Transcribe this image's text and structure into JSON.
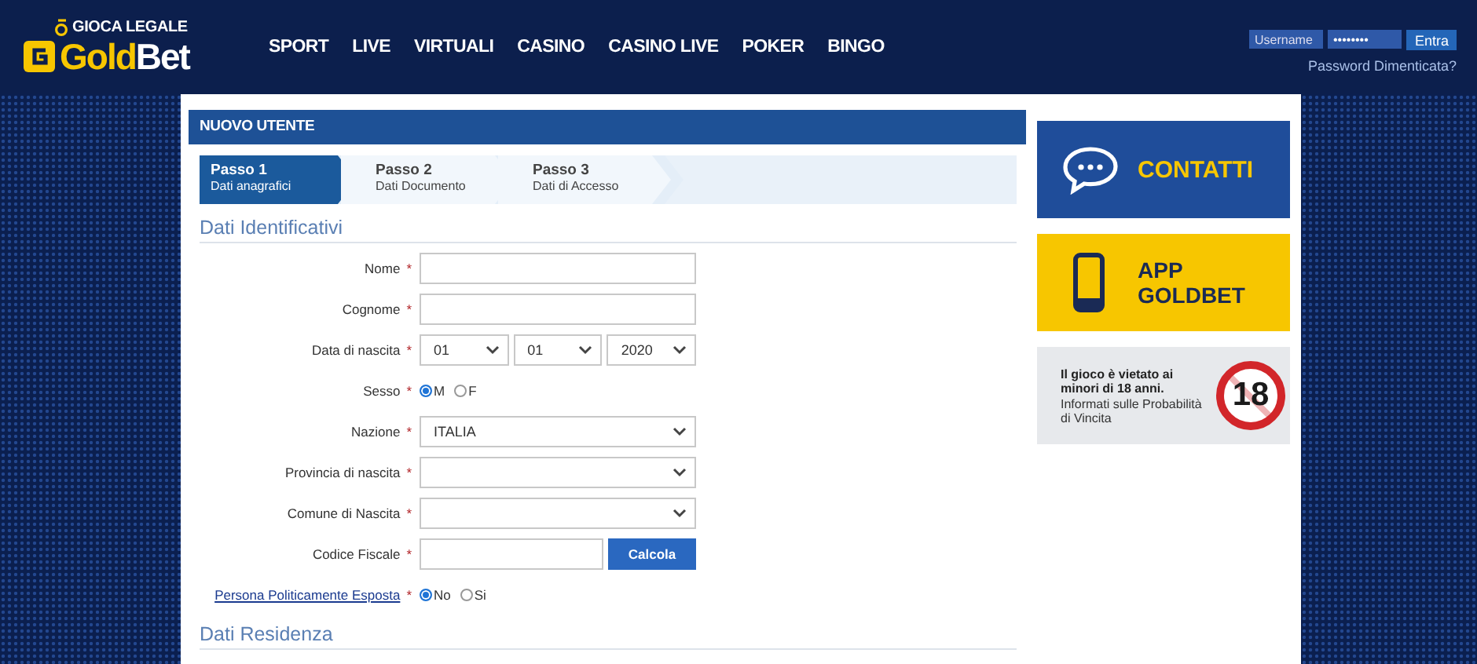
{
  "header": {
    "logo": {
      "tagline": "GIOCA LEGALE",
      "brand": [
        {
          "text": "Gold",
          "color": "#f7c600"
        },
        {
          "text": "Bet",
          "color": "#ffffff"
        }
      ]
    },
    "nav": [
      "SPORT",
      "LIVE",
      "VIRTUALI",
      "CASINO",
      "CASINO LIVE",
      "POKER",
      "BINGO"
    ],
    "login": {
      "username": {
        "placeholder": "Username"
      },
      "password": {
        "value": "••••••••"
      },
      "button": "Entra",
      "forgot_link": "Password Dimenticata?"
    }
  },
  "panel": {
    "title": "NUOVO UTENTE",
    "steps": [
      {
        "title": "Passo 1",
        "subtitle": "Dati anagrafici",
        "selected": true
      },
      {
        "title": "Passo 2",
        "subtitle": "Dati Documento",
        "selected": false
      },
      {
        "title": "Passo 3",
        "subtitle": "Dati di Accesso",
        "selected": false
      }
    ],
    "sections": [
      {
        "heading": "Dati Identificativi",
        "fields": [
          {
            "label": "Nome",
            "label_link": false,
            "mark": "*",
            "kind": "text"
          },
          {
            "label": "Cognome",
            "label_link": false,
            "mark": "*",
            "kind": "text"
          },
          {
            "label": "Data di nascita",
            "label_link": false,
            "mark": "*",
            "kind": "date",
            "values": [
              "01",
              "01",
              "2020"
            ]
          },
          {
            "label": "Sesso",
            "label_link": false,
            "mark": "*",
            "kind": "radio",
            "options": [
              {
                "label": "M",
                "selected": true
              },
              {
                "label": "F",
                "selected": false
              }
            ]
          },
          {
            "label": "Nazione",
            "label_link": false,
            "mark": "*",
            "kind": "select",
            "value": "ITALIA"
          },
          {
            "label": "Provincia di nascita",
            "label_link": false,
            "mark": "*",
            "kind": "select"
          },
          {
            "label": "Comune di Nascita",
            "label_link": false,
            "mark": "*",
            "kind": "select"
          },
          {
            "label": "Codice Fiscale",
            "label_link": false,
            "mark": "*",
            "kind": "text_button",
            "button": "Calcola"
          },
          {
            "label": "Persona Politicamente Esposta",
            "label_link": true,
            "mark": "*",
            "kind": "radio",
            "options": [
              {
                "label": "No",
                "selected": true
              },
              {
                "label": "Si",
                "selected": false
              }
            ]
          }
        ]
      },
      {
        "heading": "Dati Residenza"
      }
    ]
  },
  "sidebar": {
    "contacts": {
      "label": "CONTATTI"
    },
    "app": {
      "lines": [
        "APP",
        "GOLDBET"
      ]
    },
    "notice": {
      "warning": "Il gioco è vietato ai minori di 18 anni.",
      "link": "Informati sulle Probabilità di Vincita",
      "badge": "18"
    }
  }
}
